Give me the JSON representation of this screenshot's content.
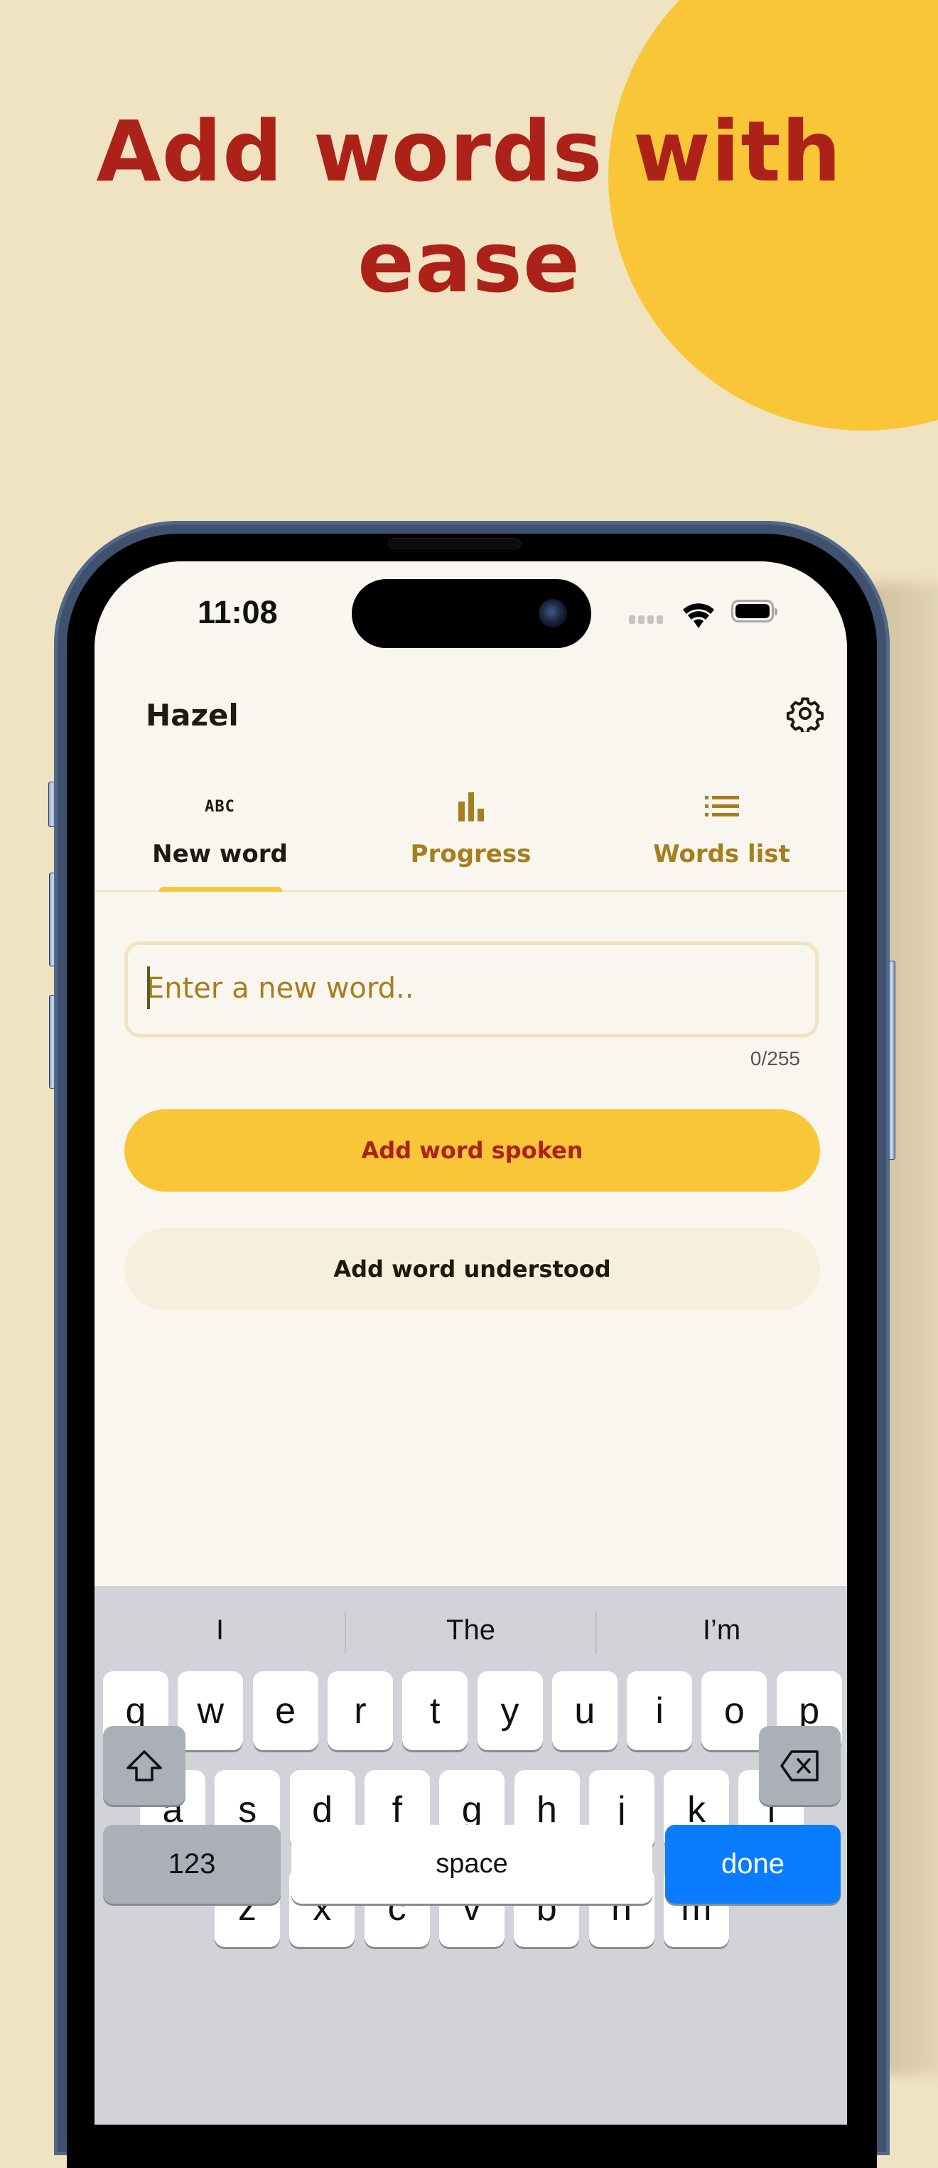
{
  "promo": {
    "headline_line1": "Add words with",
    "headline_line2": "ease",
    "colors": {
      "background": "#f0e3c1",
      "accent_circle": "#f9c638",
      "headline": "#ac2219"
    }
  },
  "status_bar": {
    "time": "11:08",
    "icons": [
      "cellular-signal-icon",
      "wifi-icon",
      "battery-icon"
    ]
  },
  "app": {
    "title": "Hazel",
    "settings_icon": "gear-icon",
    "tabs": [
      {
        "label": "New word",
        "icon": "abc-icon",
        "icon_text": "ABC",
        "active": true
      },
      {
        "label": "Progress",
        "icon": "bar-chart-icon",
        "active": false
      },
      {
        "label": "Words list",
        "icon": "list-icon",
        "active": false
      }
    ],
    "word_input": {
      "value": "",
      "placeholder": "Enter a new word..",
      "counter": "0/255"
    },
    "buttons": {
      "primary": "Add word spoken",
      "secondary": "Add word understood"
    },
    "colors": {
      "primary_button": "#f9c638",
      "primary_text": "#ac2219",
      "tab_inactive": "#a87d1d",
      "text_dark": "#21190c"
    }
  },
  "keyboard": {
    "suggestions": [
      "I",
      "The",
      "I’m"
    ],
    "row1": [
      "q",
      "w",
      "e",
      "r",
      "t",
      "y",
      "u",
      "i",
      "o",
      "p"
    ],
    "row2": [
      "a",
      "s",
      "d",
      "f",
      "g",
      "h",
      "j",
      "k",
      "l"
    ],
    "row3": [
      "z",
      "x",
      "c",
      "v",
      "b",
      "n",
      "m"
    ],
    "shift_icon": "shift-icon",
    "delete_icon": "backspace-icon",
    "numbers_label": "123",
    "space_label": "space",
    "done_label": "done",
    "done_color": "#0a7cff"
  }
}
